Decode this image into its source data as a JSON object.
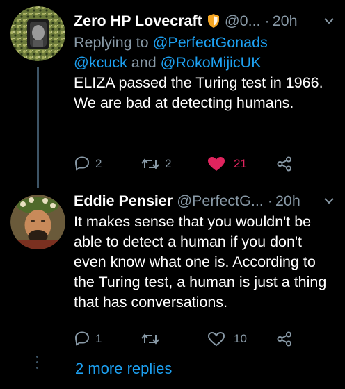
{
  "colors": {
    "background": "#000000",
    "text": "#ffffff",
    "secondary": "#8899a6",
    "link": "#1da1f2",
    "like_active": "#e0245e",
    "thread_line": "#3d5466"
  },
  "tweets": [
    {
      "display_name": "Zero HP Lovecraft",
      "badge_icon": "shield-badge-icon",
      "handle": "@0...",
      "separator": "·",
      "time": "20h",
      "reply_prefix": "Replying to",
      "mention_1": "@PerfectGonads",
      "mention_2": "@kcuck",
      "joiner": "and",
      "mention_3": "@RokoMijicUK",
      "text": "ELIZA passed the Turing test in 1966. We are bad at detecting humans.",
      "actions": {
        "reply_count": "2",
        "retweet_count": "2",
        "like_count": "21",
        "liked": true
      }
    },
    {
      "display_name": "Eddie Pensier",
      "handle": "@PerfectG...",
      "separator": "·",
      "time": "20h",
      "text": "It makes sense that you wouldn't be able to detect a human if you don't even know what one is. According to the Turing test, a human is just a thing that has conversations.",
      "actions": {
        "reply_count": "1",
        "retweet_count": "",
        "like_count": "10",
        "liked": false
      }
    }
  ],
  "more_replies": "2 more replies"
}
